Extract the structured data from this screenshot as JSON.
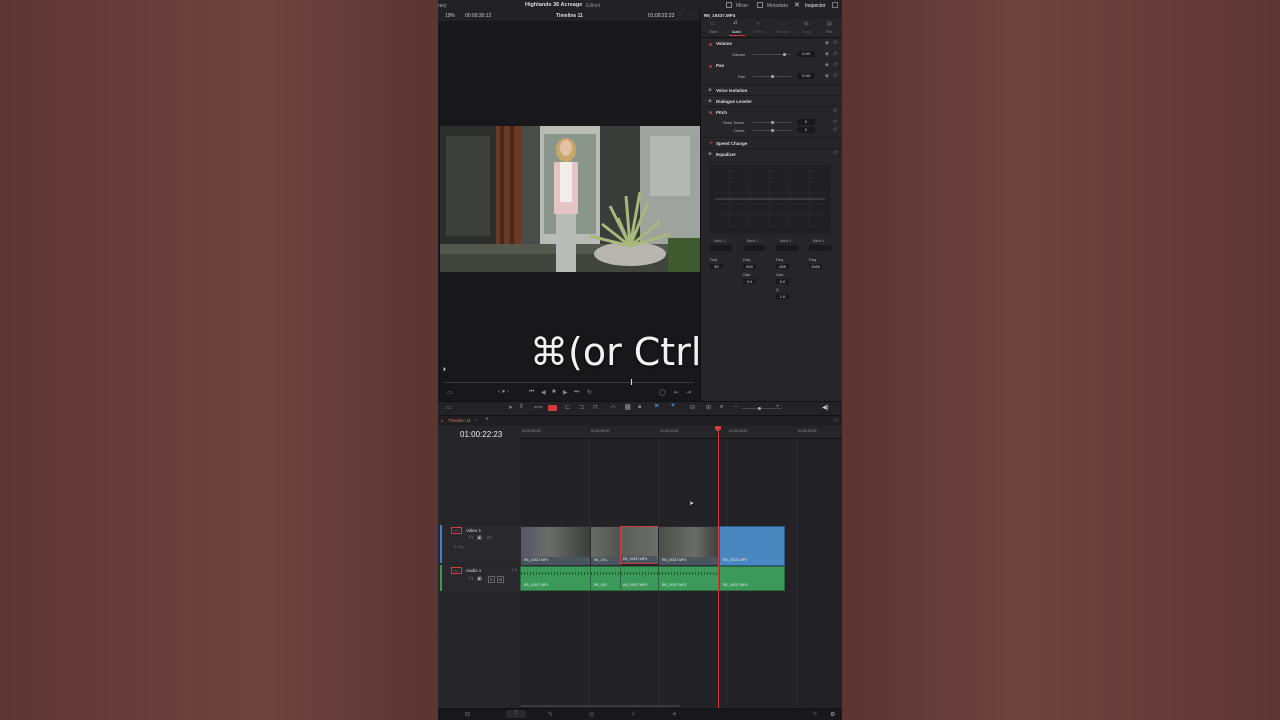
{
  "app": {
    "title": "Highlands 36 Acreage",
    "status": "Edited",
    "left_crop_label": "rary"
  },
  "top_right_tabs": [
    {
      "label": "Mixer",
      "icon": "mixer-icon"
    },
    {
      "label": "Metadata",
      "icon": "metadata-icon"
    },
    {
      "label": "Inspector",
      "icon": "inspector-icon"
    }
  ],
  "viewer": {
    "zoom": "19%",
    "source_tc": "00:00:30:12",
    "timeline_name": "Timeline 11",
    "record_tc": "01:00:22:23",
    "more": "···"
  },
  "inspector": {
    "clip_name": "R6_19337.MP4",
    "tabs": [
      "Video",
      "Audio",
      "Effects",
      "Transition",
      "Image",
      "File"
    ],
    "active_tab": "Audio",
    "sections": {
      "volume": {
        "title": "Volume",
        "param": "Volume",
        "value": "0.00"
      },
      "pan": {
        "title": "Pan",
        "param": "Pan",
        "value": "0.00"
      },
      "voice_isolation": "Voice Isolation",
      "dialogue_leveler": "Dialogue Leveler",
      "pitch": {
        "title": "Pitch",
        "semi_label": "Semi Tones",
        "semi_value": "0",
        "cents_label": "Cents",
        "cents_value": "0"
      },
      "speed_change": "Speed Change",
      "equalizer": "Equalizer"
    },
    "eq": {
      "bands": [
        "Band 1",
        "Band 2",
        "Band 3",
        "Band 4"
      ],
      "freq_label": "Freq",
      "gain_label": "Gain",
      "q_label": "Q",
      "freq_values": [
        "50",
        "500",
        "265",
        "1060"
      ],
      "gain_values": [
        "0.0",
        "0.0"
      ],
      "q_value": "1.0"
    }
  },
  "overlay": {
    "text": "⌘(or Ctrl)+B"
  },
  "timeline": {
    "tab_name": "Timeline 11",
    "timecode": "01:00:22:23",
    "ruler": [
      "01:00:00:00",
      "01:00:05:00",
      "01:00:10:00",
      "01:00:15:00",
      "01:00:20:00"
    ],
    "video_track": {
      "id": "V1",
      "name": "Video 1",
      "clip_count": "5 Clips"
    },
    "audio_track": {
      "id": "A1",
      "name": "Audio 1",
      "channel": "2.0"
    },
    "video_clips": [
      "R6_19337.MP4",
      "R6_193...",
      "R6_19337.MP4",
      "R6_19337.MP4",
      "R6_19337.MP4"
    ],
    "audio_clips": [
      "R6_19337.MP4",
      "R6_193...",
      "R6_19337.MP4",
      "R6_19337.MP4",
      "R6_19337.MP4"
    ]
  },
  "colors": {
    "accent_red": "#d23c3c",
    "video_clip": "#4b5a68",
    "audio_clip": "#3b9a5a",
    "selected_clip": "#4a86c0"
  }
}
